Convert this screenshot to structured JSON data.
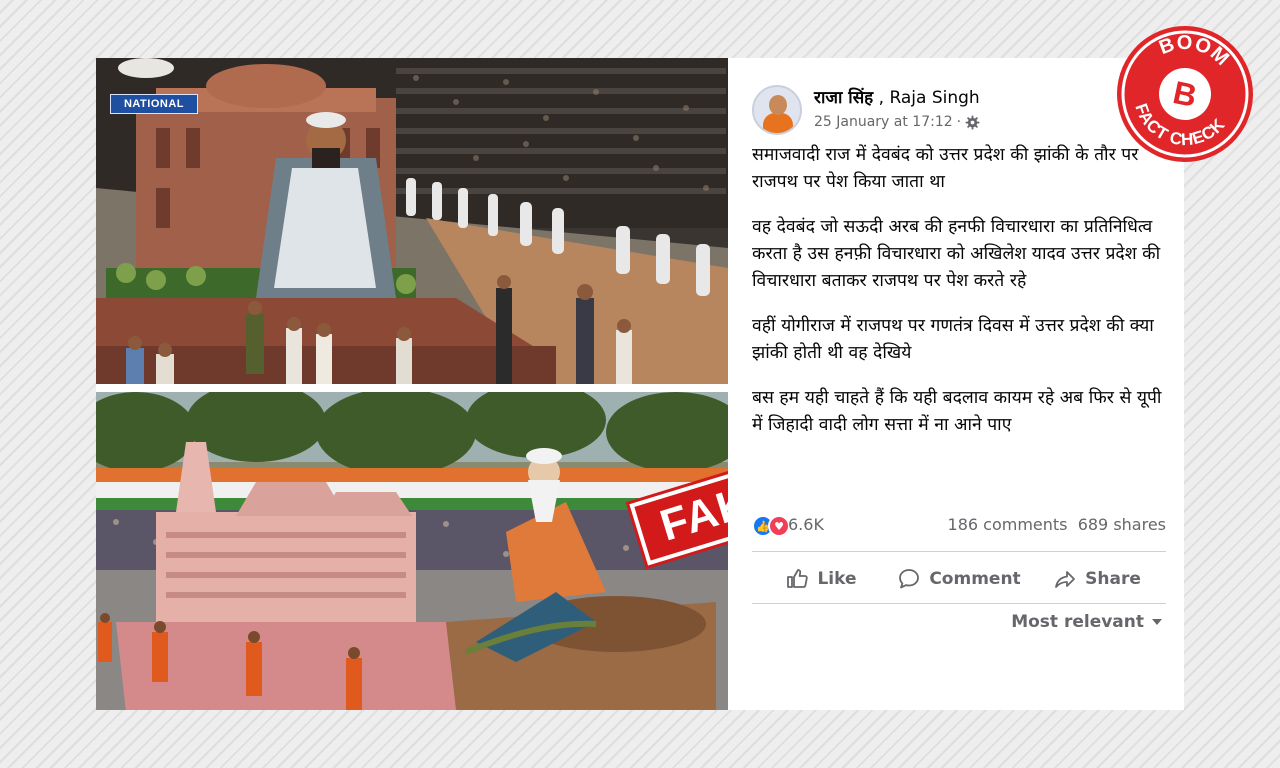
{
  "top_photo": {
    "overlay_label": "NATIONAL"
  },
  "bottom_photo": {
    "stamp_text": "FAKE"
  },
  "post": {
    "author_hindi": "राजा सिंह",
    "author_sep": " , ",
    "author_english": "Raja Singh",
    "timestamp": "25 January at 17:12",
    "dot": "·",
    "paragraphs": [
      "समाजवादी राज में देवबंद को उत्तर प्रदेश की झांकी के तौर पर राजपथ पर पेश किया जाता था",
      "वह देवबंद जो सऊदी अरब की हनफी विचारधारा का प्रतिनिधित्व करता है उस हनफ़ी विचारधारा को अखिलेश यादव उत्तर प्रदेश की विचारधारा बताकर राजपथ पर पेश करते रहे",
      "वहीं योगीराज में राजपथ पर गणतंत्र दिवस में उत्तर प्रदेश की क्या झांकी होती थी वह देखिये",
      "बस हम यही चाहते हैं कि यही बदलाव कायम रहे अब फिर से यूपी में जिहादी वादी लोग सत्ता में ना आने पाए"
    ],
    "reaction_count": "6.6K",
    "comments": "186 comments",
    "shares": "689 shares",
    "actions": {
      "like": "Like",
      "comment": "Comment",
      "share": "Share"
    },
    "sort_label": "Most relevant"
  },
  "badge": {
    "top_text": "BOOM",
    "letter": "B",
    "bottom_text": "FACT CHECK"
  },
  "colors": {
    "facebook_blue": "#1877f2",
    "boom_red": "#e1262a",
    "fake_red": "#d21a1a",
    "meta_gray": "#65676b"
  }
}
